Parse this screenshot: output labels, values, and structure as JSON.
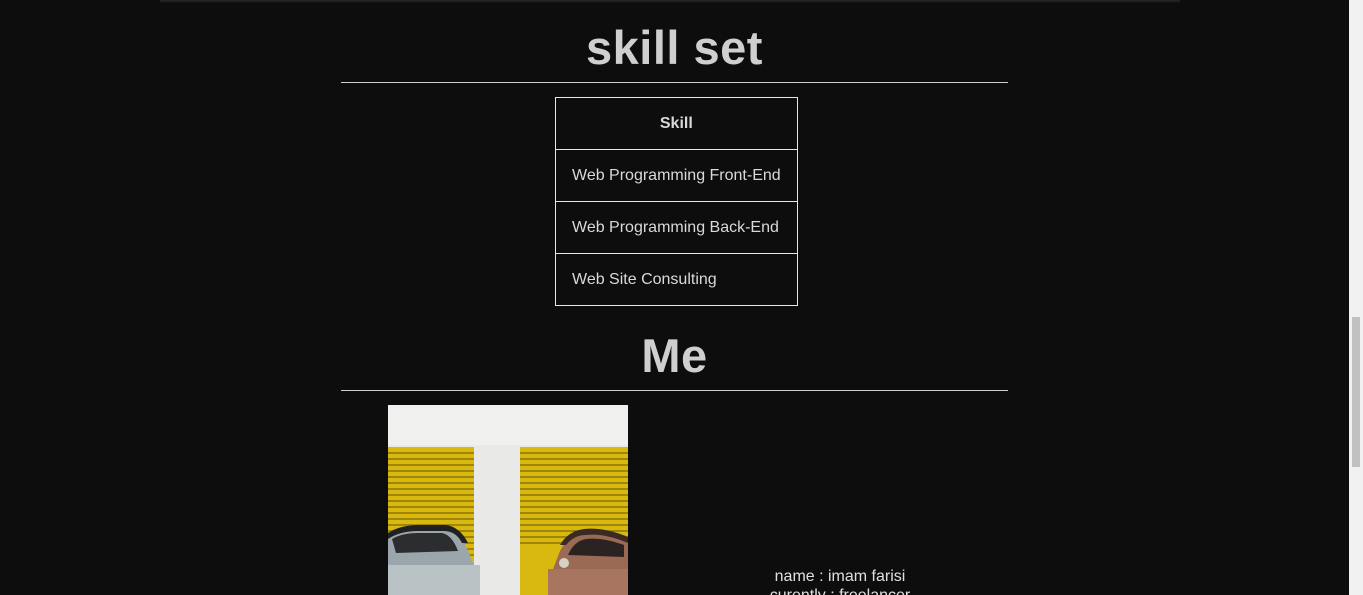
{
  "skills_section": {
    "title": "skill set",
    "table": {
      "header": "Skill",
      "rows": [
        "Web Programming Front-End",
        "Web Programming Back-End",
        "Web Site Consulting"
      ]
    }
  },
  "me_section": {
    "title": "Me",
    "photo_icon": "vintage-cars-photo",
    "info": {
      "name": "name : imam farisi",
      "status": "curently : freelancer"
    }
  },
  "colors": {
    "background": "#0d0d0d",
    "text": "#d9d9d9",
    "accent_yellow": "#e3c51b"
  }
}
